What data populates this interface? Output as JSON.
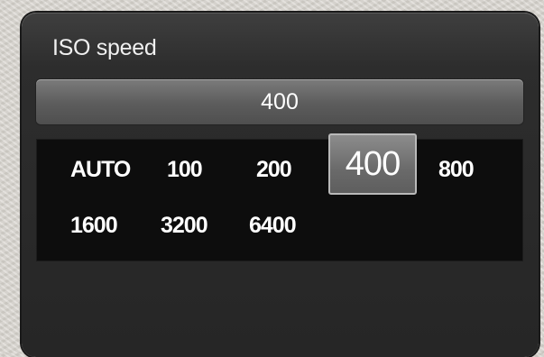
{
  "menu": {
    "title": "ISO speed",
    "current_value": "400",
    "options": [
      "AUTO",
      "100",
      "200",
      "400",
      "800",
      "1600",
      "3200",
      "6400"
    ],
    "selected": "400"
  }
}
